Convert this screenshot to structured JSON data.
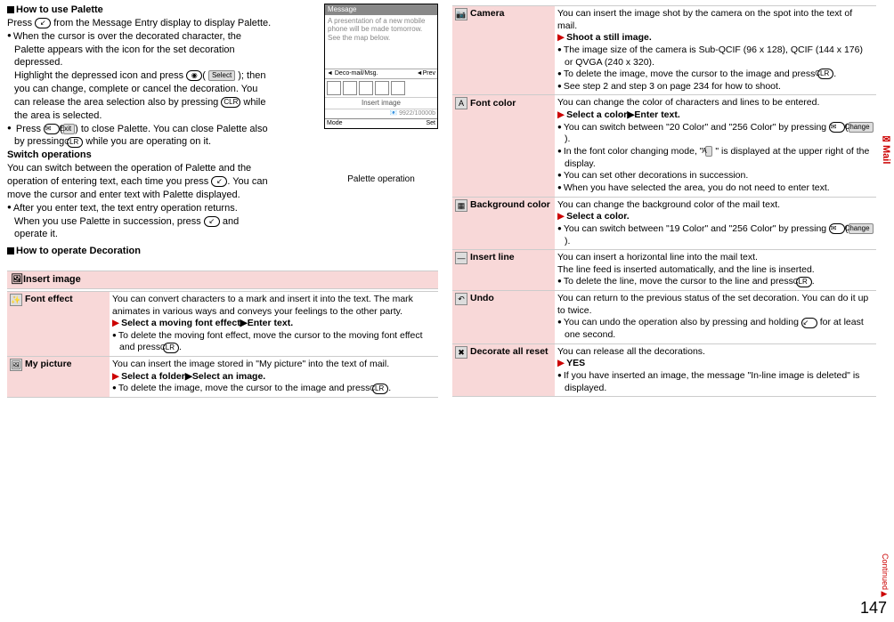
{
  "page_number": "147",
  "side_tab": "Mail",
  "continued": "Continued▶",
  "left": {
    "h1": "How to use Palette",
    "p1a": "Press ",
    "p1b": " from the Message Entry display to display Palette.",
    "b1": "When the cursor is over the decorated character, the Palette appears with the icon for the set decoration depressed.",
    "b1sub_a": "Highlight the depressed icon and press ",
    "b1sub_b": "( ",
    "b1sub_btn": "Select",
    "b1sub_c": " ); then you can change, complete or cancel the decoration. You can release the area selection also by pressing ",
    "b1sub_d": " while the area is selected.",
    "b2a": "Press ",
    "b2_btn": "Exit",
    "b2b": ") to close Palette. You can close Palette also by pressing ",
    "b2c": " while you are operating on it.",
    "h2": "Switch operations",
    "p2a": "You can switch between the operation of Palette and the operation of entering text, each time you press ",
    "p2b": ". You can move the cursor and enter text with Palette displayed.",
    "b3": "After you enter text, the text entry operation returns.",
    "b3sub_a": "When you use Palette in succession, press ",
    "b3sub_b": " and operate it.",
    "h3": "How to operate Decoration",
    "insert_image": "Insert image",
    "screenshot": {
      "title": "Message",
      "body": "A presentation of a new mobile phone will be made tomorrow. See the map below.",
      "ruler_left": "Deco-mail/Msg.",
      "ruler_right": "Prev",
      "insert": "Insert image",
      "status": "9922/10000b",
      "b1": "Mode",
      "b2": "Set",
      "caption": "Palette operation"
    },
    "rows": {
      "font_effect": {
        "label": "Font effect",
        "t1": "You can convert characters to a mark and insert it into the text. The mark animates in various ways and conveys your feelings to the other party.",
        "t2": "Select a moving font effect▶Enter text.",
        "t3": "To delete the moving font effect, move the cursor to the moving font effect and press "
      },
      "my_picture": {
        "label": "My picture",
        "t1": "You can insert the image stored in \"My picture\" into the text of mail.",
        "t2": "Select a folder▶Select an image.",
        "t3": "To delete the image, move the cursor to the image and press "
      }
    }
  },
  "right": {
    "rows": {
      "camera": {
        "label": "Camera",
        "t1": "You can insert the image shot by the camera on the spot into the text of mail.",
        "t2": "Shoot a still image.",
        "t3": "The image size of the camera is Sub-QCIF (96 x 128), QCIF (144 x 176) or QVGA (240 x 320).",
        "t4": "To delete the image, move the cursor to the image and press ",
        "t5": "See step 2 and step 3 on page 234 for how to shoot."
      },
      "font_color": {
        "label": "Font color",
        "t1": "You can change the color of characters and lines to be entered.",
        "t2": "Select a color▶Enter text.",
        "t3": "You can switch between \"20 Color\" and \"256 Color\" by pressing ",
        "t3_btn": "Change",
        "t4": "In the font color changing mode, \" ",
        "t4b": " \" is displayed at the upper right of the display.",
        "t5": "You can set other decorations in succession.",
        "t6": "When you have selected the area, you do not need to enter text."
      },
      "bg_color": {
        "label": "Background color",
        "t1": "You can change the background color of the mail text.",
        "t2": "Select a color.",
        "t3": "You can switch between \"19 Color\" and \"256 Color\" by pressing ",
        "t3_btn": "Change"
      },
      "insert_line": {
        "label": "Insert line",
        "t1": "You can insert a horizontal line into the mail text.",
        "t2": "The line feed is inserted automatically, and the line is inserted.",
        "t3": "To delete the line, move the cursor to the line and press "
      },
      "undo": {
        "label": "Undo",
        "t1": "You can return to the previous status of the set decoration. You can do it up to twice.",
        "t2": "You can undo the operation also by pressing and holding ",
        "t2b": " for at least one second."
      },
      "reset": {
        "label": "Decorate all reset",
        "t1": "You can release all the decorations.",
        "t2": "YES",
        "t3": "If you have inserted an image, the message \"In-line image is deleted\" is displayed."
      }
    }
  },
  "keys": {
    "clr": "CLR",
    "mail": "✉",
    "curve": "↙",
    "dot": "◉",
    "A": "A"
  }
}
